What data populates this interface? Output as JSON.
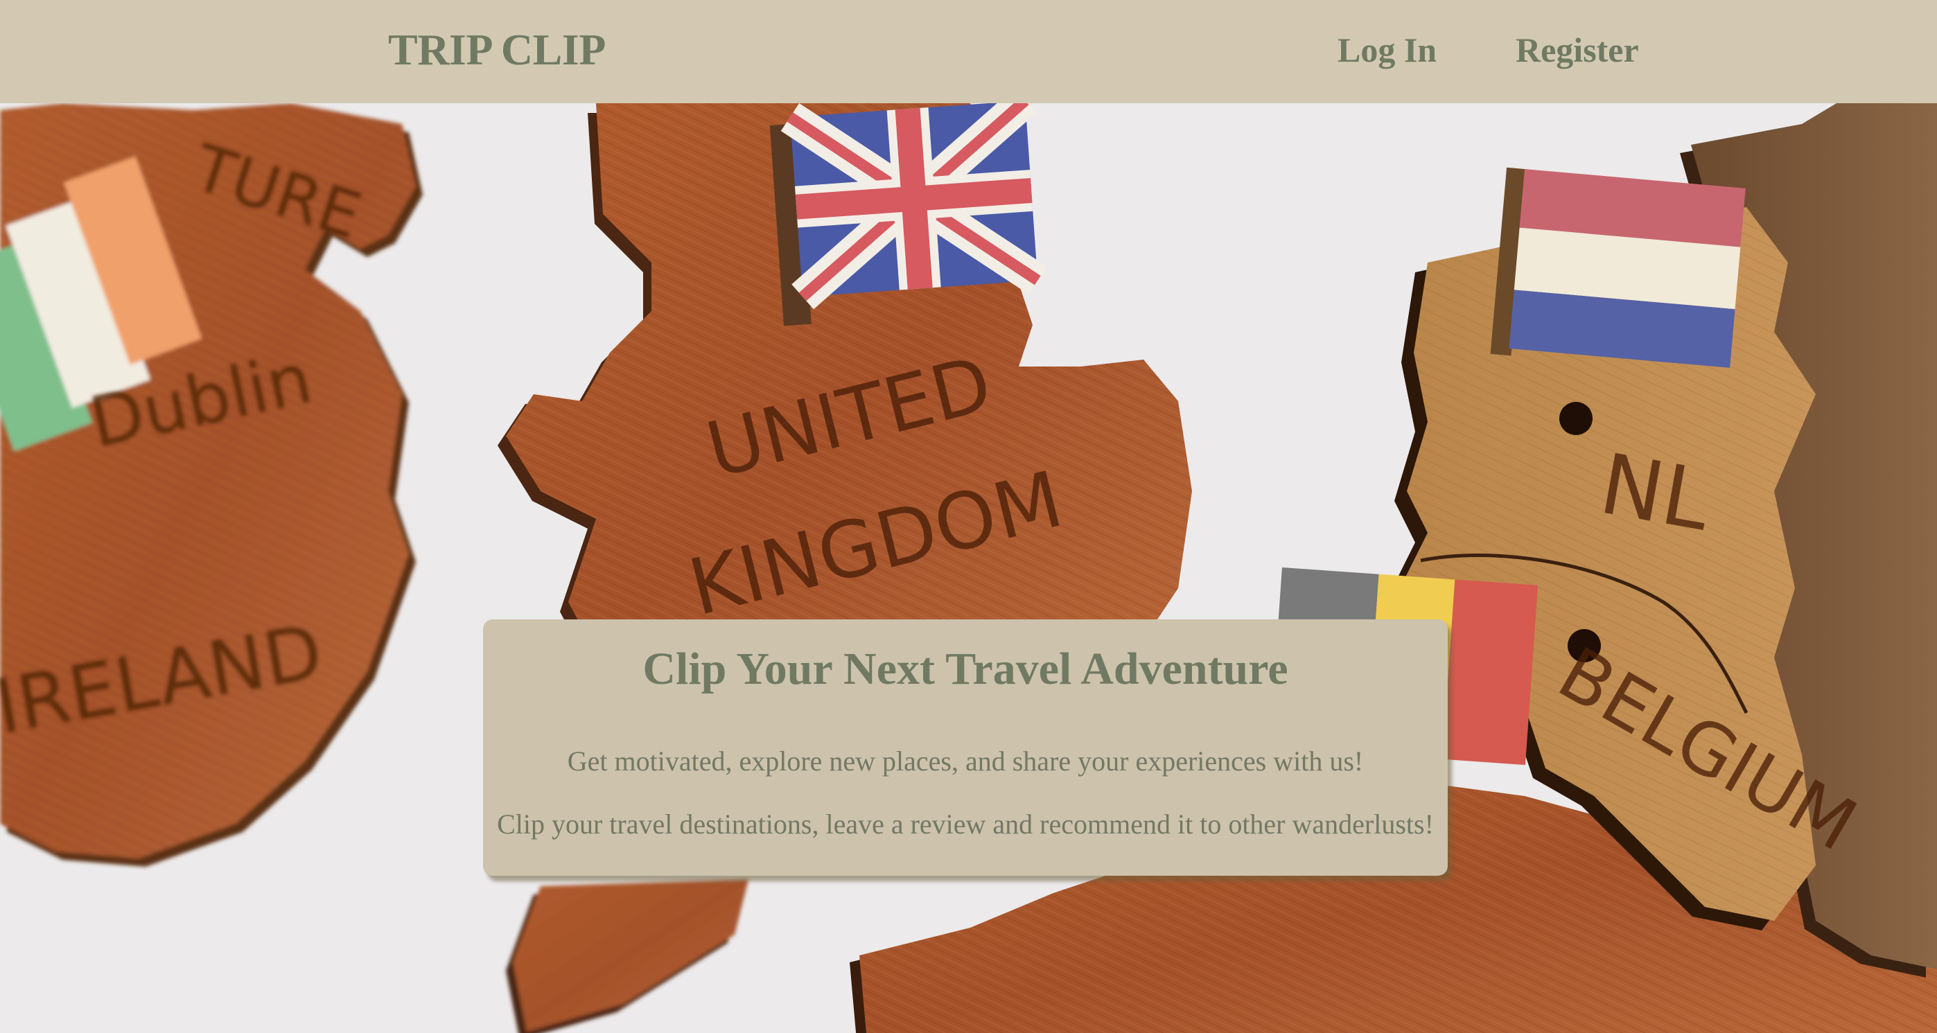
{
  "header": {
    "brand": "TRIP CLIP",
    "nav": {
      "login": "Log In",
      "register": "Register"
    }
  },
  "hero": {
    "image": {
      "description_icon": "wooden-europe-map-puzzle-image",
      "labels": {
        "ireland_top": "TURE",
        "dublin": "Dublin",
        "ireland": "IRELAND",
        "uk_line1": "UNITED",
        "uk_line2": "KINGDOM",
        "nl": "NL",
        "belgium": "BELGIUM"
      }
    },
    "card": {
      "title": "Clip Your Next Travel Adventure",
      "line1": "Get motivated, explore new places, and share your experiences with us!",
      "line2": "Clip your travel destinations, leave a review and recommend it to other wanderlusts!"
    }
  },
  "colors": {
    "header_bg": "#d3c9b3",
    "brand_text": "#707a62",
    "card_bg": "#cdc2ac",
    "card_text": "#727863",
    "wood": "#a8552b",
    "wood_light": "#c98a48"
  }
}
